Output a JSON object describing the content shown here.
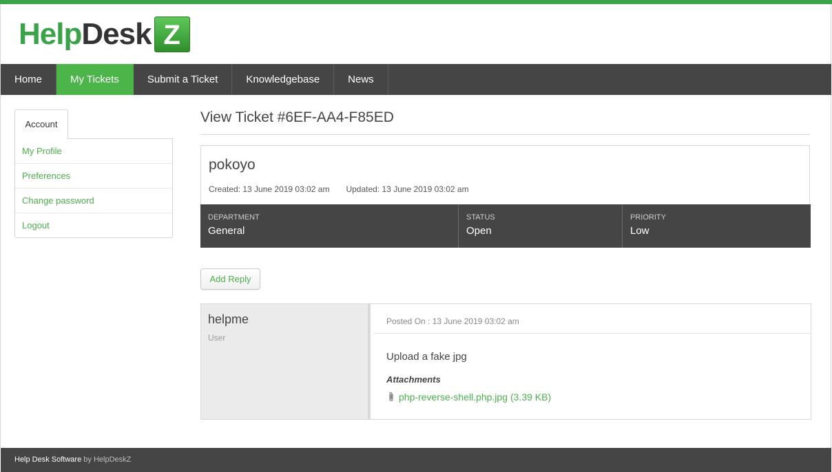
{
  "logo": {
    "part1": "Help",
    "part2": "Desk",
    "badge": "Z"
  },
  "nav": {
    "items": [
      {
        "label": "Home"
      },
      {
        "label": "My Tickets"
      },
      {
        "label": "Submit a Ticket"
      },
      {
        "label": "Knowledgebase"
      },
      {
        "label": "News"
      }
    ],
    "active": "My Tickets"
  },
  "sidebar": {
    "tab_label": "Account",
    "links": [
      {
        "label": "My Profile"
      },
      {
        "label": "Preferences"
      },
      {
        "label": "Change password"
      },
      {
        "label": "Logout"
      }
    ]
  },
  "ticket": {
    "page_title": "View Ticket #6EF-AA4-F85ED",
    "subject": "pokoyo",
    "created": "Created: 13 June 2019 03:02 am",
    "updated": "Updated: 13 June 2019 03:02 am",
    "meta": [
      {
        "label": "DEPARTMENT",
        "value": "General"
      },
      {
        "label": "STATUS",
        "value": "Open"
      },
      {
        "label": "PRIORITY",
        "value": "Low"
      }
    ]
  },
  "actions": {
    "add_reply": "Add Reply"
  },
  "message": {
    "author": "helpme",
    "role": "User",
    "posted_on": "Posted On : 13 June 2019 03:02 am",
    "body": "Upload a fake jpg",
    "attachments_heading": "Attachments",
    "attachment": {
      "name": "php-reverse-shell.php.jpg",
      "size": "(3.39 KB)",
      "icon": "paperclip-icon"
    }
  },
  "footer": {
    "main": "Help Desk Software",
    "by": "by HelpDeskZ"
  },
  "colors": {
    "accent": "#4cb54a",
    "nav_bg": "#454545",
    "link": "#4cae4c"
  }
}
